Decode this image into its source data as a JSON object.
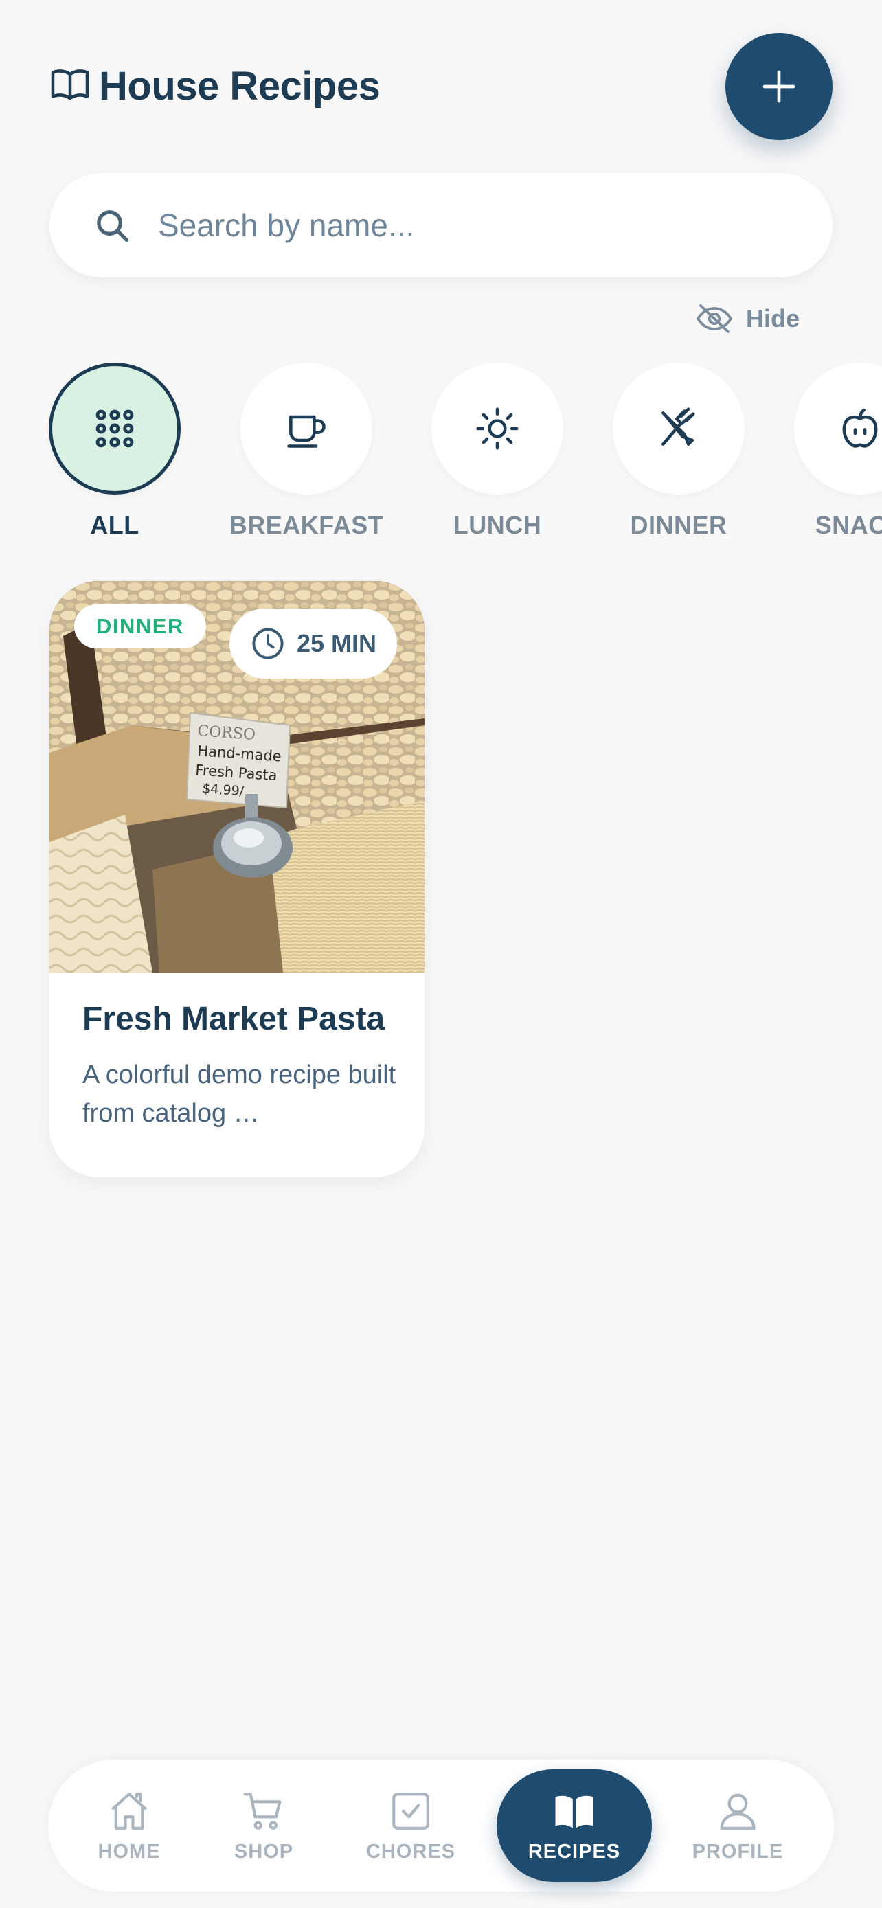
{
  "header": {
    "title": "House Recipes",
    "book_icon": "book-open-icon",
    "add_icon": "plus-icon"
  },
  "search": {
    "placeholder": "Search by name...",
    "value": "",
    "icon": "search-icon"
  },
  "hide_toggle": {
    "label": "Hide",
    "icon": "eye-off-icon"
  },
  "categories": [
    {
      "label": "ALL",
      "icon": "grid-icon",
      "active": true
    },
    {
      "label": "BREAKFAST",
      "icon": "cup-icon",
      "active": false
    },
    {
      "label": "LUNCH",
      "icon": "sun-icon",
      "active": false
    },
    {
      "label": "DINNER",
      "icon": "utensils-icon",
      "active": false
    },
    {
      "label": "SNACK",
      "icon": "apple-icon",
      "active": false
    }
  ],
  "recipes": [
    {
      "category_badge": "DINNER",
      "time": "25 MIN",
      "title": "Fresh Market Pasta",
      "description": "A colorful demo recipe built from catalog …",
      "image": "fresh-pasta-photo",
      "sign_lines": [
        "CORSO",
        "Hand-made",
        "Fresh Pasta",
        "$4,99/"
      ]
    }
  ],
  "bottom_nav": [
    {
      "label": "HOME",
      "icon": "home-icon",
      "active": false
    },
    {
      "label": "SHOP",
      "icon": "cart-icon",
      "active": false
    },
    {
      "label": "CHORES",
      "icon": "checkbox-icon",
      "active": false
    },
    {
      "label": "RECIPES",
      "icon": "book-icon",
      "active": true
    },
    {
      "label": "PROFILE",
      "icon": "user-icon",
      "active": false
    }
  ],
  "colors": {
    "primary": "#1f4b6e",
    "text": "#1d3b53",
    "muted": "#7c8a98",
    "accent_green": "#22b07a",
    "active_category_bg": "#d8f1e2",
    "background": "#f8f8f8"
  }
}
